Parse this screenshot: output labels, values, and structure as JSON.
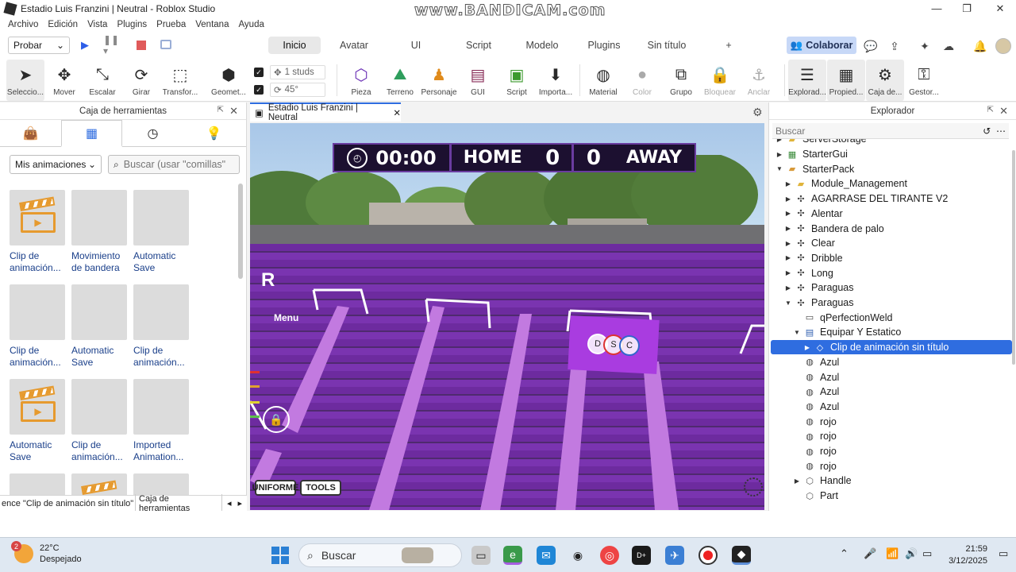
{
  "titlebar": {
    "title": "Estadio Luis Franzini | Neutral - Roblox Studio",
    "watermark": "www.BANDICAM.com",
    "minimize": "—",
    "maximize": "❐",
    "close": "✕"
  },
  "menu": [
    "Archivo",
    "Edición",
    "Vista",
    "Plugins",
    "Prueba",
    "Ventana",
    "Ayuda"
  ],
  "ribbon": {
    "test_mode": "Probar",
    "tabs": [
      "Inicio",
      "Avatar",
      "UI",
      "Script",
      "Modelo",
      "Plugins",
      "Sin título",
      "+"
    ],
    "active_tab": "Inicio",
    "collaborate": "Colaborar"
  },
  "toolbar": {
    "tools": [
      "Seleccio...",
      "Mover",
      "Escalar",
      "Girar",
      "Transfor...",
      "Geomet..."
    ],
    "move_snap": "1 studs",
    "rotate_snap": "45°",
    "insert_tools": [
      "Pieza",
      "Terreno",
      "Personaje",
      "GUI",
      "Script",
      "Importa..."
    ],
    "edit_tools": [
      "Material",
      "Color",
      "Grupo",
      "Bloquear",
      "Anclar"
    ],
    "panel_tools": [
      "Explorad...",
      "Propied...",
      "Caja de...",
      "Gestor..."
    ]
  },
  "toolbox": {
    "title": "Caja de herramientas",
    "filter": "Mis animaciones",
    "search_placeholder": "Buscar (usar \"comillas\"",
    "assets": [
      {
        "name": "Clip de animación...",
        "thumb": "clapper"
      },
      {
        "name": "Movimiento de bandera",
        "thumb": "blank"
      },
      {
        "name": "Automatic Save",
        "thumb": "blank"
      },
      {
        "name": "Clip de animación...",
        "thumb": "blank"
      },
      {
        "name": "Automatic Save",
        "thumb": "blank"
      },
      {
        "name": "Clip de animación...",
        "thumb": "blank"
      },
      {
        "name": "Automatic Save",
        "thumb": "clapper"
      },
      {
        "name": "Clip de animación...",
        "thumb": "blank"
      },
      {
        "name": "Imported Animation...",
        "thumb": "blank"
      },
      {
        "name": "",
        "thumb": "blank"
      },
      {
        "name": "",
        "thumb": "clapper"
      },
      {
        "name": "",
        "thumb": "blank"
      }
    ],
    "bottom_tab_1": "ence \"Clip de animación sin título\"",
    "bottom_tab_2": "Caja de herramientas"
  },
  "viewport": {
    "tab_title": "Estadio Luis Franzini | Neutral",
    "score": {
      "time": "00:00",
      "home": "HOME",
      "home_score": "0",
      "away_score": "0",
      "away": "AWAY"
    },
    "letter": "R",
    "menu_label": "Menu",
    "button_uniforme": "UNIFORME",
    "button_tools": "TOOLS",
    "flag_letters": [
      "D",
      "S",
      "C"
    ]
  },
  "explorer": {
    "title": "Explorador",
    "search_placeholder": "Buscar",
    "nodes": [
      {
        "label": "ServerStorage",
        "depth": 0,
        "arrow": "▶",
        "icon": "folder-icon"
      },
      {
        "label": "StarterGui",
        "depth": 0,
        "arrow": "▶",
        "icon": "gui-icon"
      },
      {
        "label": "StarterPack",
        "depth": 0,
        "arrow": "▼",
        "icon": "pack-icon"
      },
      {
        "label": "Module_Management",
        "depth": 1,
        "arrow": "▶",
        "icon": "folder-icon"
      },
      {
        "label": "AGARRASE DEL TIRANTE V2",
        "depth": 1,
        "arrow": "▶",
        "icon": "tool-icon"
      },
      {
        "label": "Alentar",
        "depth": 1,
        "arrow": "▶",
        "icon": "tool-icon"
      },
      {
        "label": "Bandera de palo",
        "depth": 1,
        "arrow": "▶",
        "icon": "tool-icon"
      },
      {
        "label": "Clear",
        "depth": 1,
        "arrow": "▶",
        "icon": "tool-icon"
      },
      {
        "label": "Dribble",
        "depth": 1,
        "arrow": "▶",
        "icon": "tool-icon"
      },
      {
        "label": "Long",
        "depth": 1,
        "arrow": "▶",
        "icon": "tool-icon"
      },
      {
        "label": "Paraguas",
        "depth": 1,
        "arrow": "▶",
        "icon": "tool-icon"
      },
      {
        "label": "Paraguas",
        "depth": 1,
        "arrow": "▼",
        "icon": "tool-icon"
      },
      {
        "label": "qPerfectionWeld",
        "depth": 2,
        "arrow": "",
        "icon": "script-icon"
      },
      {
        "label": "Equipar Y Estatico",
        "depth": 2,
        "arrow": "▼",
        "icon": "localscript-icon"
      },
      {
        "label": "Clip de animación sin título",
        "depth": 3,
        "arrow": "▶",
        "icon": "animation-icon",
        "selected": true
      },
      {
        "label": "Azul",
        "depth": 2,
        "arrow": "",
        "icon": "sound-icon"
      },
      {
        "label": "Azul",
        "depth": 2,
        "arrow": "",
        "icon": "sound-icon"
      },
      {
        "label": "Azul",
        "depth": 2,
        "arrow": "",
        "icon": "sound-icon"
      },
      {
        "label": "Azul",
        "depth": 2,
        "arrow": "",
        "icon": "sound-icon"
      },
      {
        "label": "rojo",
        "depth": 2,
        "arrow": "",
        "icon": "sound-icon"
      },
      {
        "label": "rojo",
        "depth": 2,
        "arrow": "",
        "icon": "sound-icon"
      },
      {
        "label": "rojo",
        "depth": 2,
        "arrow": "",
        "icon": "sound-icon"
      },
      {
        "label": "rojo",
        "depth": 2,
        "arrow": "",
        "icon": "sound-icon"
      },
      {
        "label": "Handle",
        "depth": 2,
        "arrow": "▶",
        "icon": "part-icon"
      },
      {
        "label": "Part",
        "depth": 2,
        "arrow": "",
        "icon": "part-icon"
      }
    ]
  },
  "taskbar": {
    "temperature": "22°C",
    "weather": "Despejado",
    "notification_count": "2",
    "search": "Buscar",
    "time": "21:59",
    "date": "3/12/2025"
  }
}
